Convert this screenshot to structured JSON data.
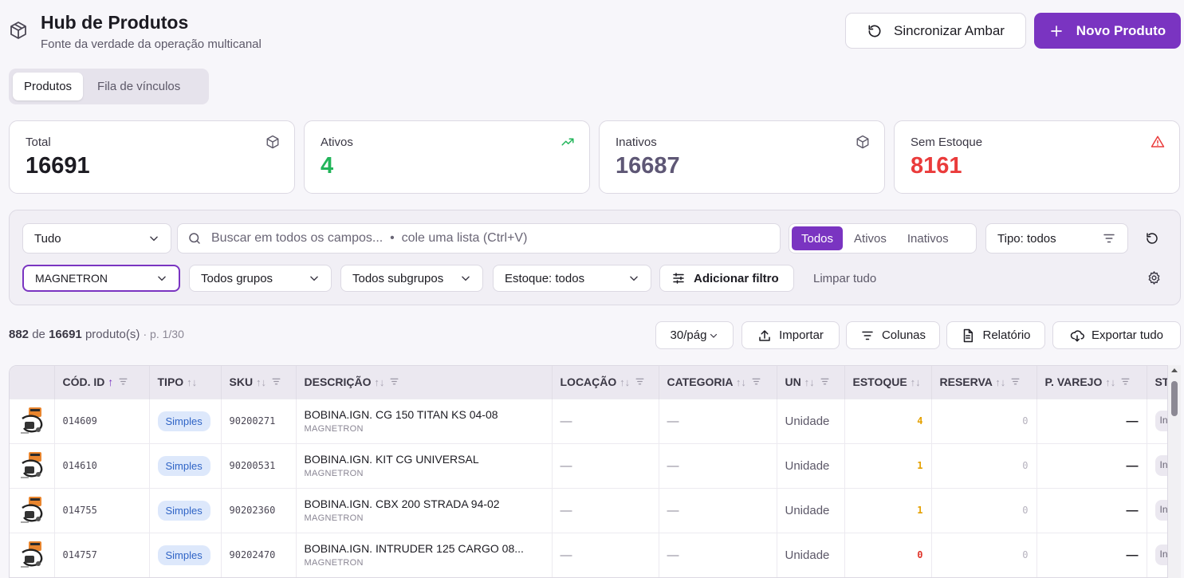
{
  "header": {
    "icon": "box-icon",
    "title": "Hub de Produtos",
    "subtitle": "Fonte da verdade da operação multicanal",
    "sync_label": "Sincronizar Ambar",
    "new_label": "Novo Produto"
  },
  "tabs": [
    {
      "label": "Produtos",
      "active": true
    },
    {
      "label": "Fila de vínculos",
      "active": false
    }
  ],
  "stats": [
    {
      "label": "Total",
      "value": "16691",
      "icon": "box-icon",
      "color": "#1c1b22"
    },
    {
      "label": "Ativos",
      "value": "4",
      "icon": "trending-up-icon",
      "color": "#22b55a"
    },
    {
      "label": "Inativos",
      "value": "16687",
      "icon": "box-icon",
      "color": "#5e5775"
    },
    {
      "label": "Sem Estoque",
      "value": "8161",
      "icon": "warning-icon",
      "color": "#ea3b3b"
    }
  ],
  "filters": {
    "scope": "Tudo",
    "search_placeholder": "Buscar em todos os campos...  •  cole uma lista (Ctrl+V)",
    "status_segments": [
      "Todos",
      "Ativos",
      "Inativos"
    ],
    "status_active": "Todos",
    "tipo": "Tipo: todos",
    "brand": "MAGNETRON",
    "grupos": "Todos grupos",
    "subgrupos": "Todos subgrupos",
    "estoque": "Estoque: todos",
    "add_filter": "Adicionar filtro",
    "clear_all": "Limpar tudo"
  },
  "summary": {
    "shown": "882",
    "of": "de",
    "total": "16691",
    "suffix": "produto(s)",
    "page": "· p. 1/30"
  },
  "toolbar": {
    "per_page": "30/pág",
    "import": "Importar",
    "columns": "Colunas",
    "report": "Relatório",
    "export": "Exportar tudo"
  },
  "table": {
    "headers": [
      "CÓD. ID",
      "TIPO",
      "SKU",
      "DESCRIÇÃO",
      "LOCAÇÃO",
      "CATEGORIA",
      "UN",
      "ESTOQUE",
      "RESERVA",
      "P. VAREJO",
      "ST"
    ],
    "rows": [
      {
        "cod": "014609",
        "tipo": "Simples",
        "sku": "90200271",
        "desc": "BOBINA.IGN. CG 150 TITAN KS 04-08",
        "brand": "MAGNETRON",
        "locacao": "—",
        "categoria": "—",
        "un": "Unidade",
        "estoque": "4",
        "estoque_color": "#e5a100",
        "reserva": "0",
        "pvarejo": "—",
        "st": "In"
      },
      {
        "cod": "014610",
        "tipo": "Simples",
        "sku": "90200531",
        "desc": "BOBINA.IGN. KIT CG UNIVERSAL",
        "brand": "MAGNETRON",
        "locacao": "—",
        "categoria": "—",
        "un": "Unidade",
        "estoque": "1",
        "estoque_color": "#e5a100",
        "reserva": "0",
        "pvarejo": "—",
        "st": "In"
      },
      {
        "cod": "014755",
        "tipo": "Simples",
        "sku": "90202360",
        "desc": "BOBINA.IGN. CBX 200 STRADA 94-02",
        "brand": "MAGNETRON",
        "locacao": "—",
        "categoria": "—",
        "un": "Unidade",
        "estoque": "1",
        "estoque_color": "#e5a100",
        "reserva": "0",
        "pvarejo": "—",
        "st": "In"
      },
      {
        "cod": "014757",
        "tipo": "Simples",
        "sku": "90202470",
        "desc": "BOBINA.IGN. INTRUDER 125 CARGO 08...",
        "brand": "MAGNETRON",
        "locacao": "—",
        "categoria": "—",
        "un": "Unidade",
        "estoque": "0",
        "estoque_color": "#e0352b",
        "reserva": "0",
        "pvarejo": "—",
        "st": "In"
      }
    ]
  }
}
